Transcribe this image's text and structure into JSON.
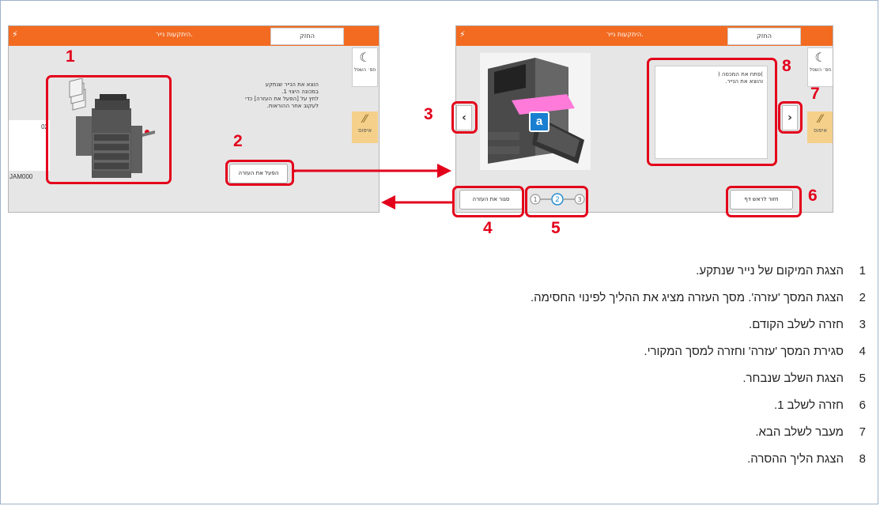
{
  "left_panel": {
    "bar_title": "היתקעות נייר.",
    "tab_label": "החזק",
    "sleep_label": "חס׳ השפל",
    "reset_label": "איפוס",
    "instructions": [
      "הוצא את הנייר שנתקע",
      "במכונה היצוי 1.",
      "לחץ על [הפעל את העזרה] כדי",
      "לעקוב אחר ההוראות."
    ],
    "help_button": "הפעל את העזרה",
    "partial_value": "02",
    "jam_code": "JAM000"
  },
  "right_panel": {
    "bar_title": "היתקעות נייר.",
    "tab_label": "החזק",
    "sleep_label": "חס׳ השפל",
    "reset_label": "איפוס",
    "instruction_lines": [
      ")פתח את המכסה (",
      "והוצא את הנייר."
    ],
    "close_help_button": "סגור את העזרה",
    "back_to_start_button": "חזור לראש דף",
    "part_badge": "a",
    "steps": [
      "1",
      "2",
      "3"
    ]
  },
  "callouts": [
    "1",
    "2",
    "3",
    "4",
    "5",
    "6",
    "7",
    "8"
  ],
  "descriptions": [
    {
      "num": "1",
      "text": "הצגת המיקום של נייר שנתקע."
    },
    {
      "num": "2",
      "text": "הצגת המסך 'עזרה'. מסך העזרה מציג את ההליך לפינוי החסימה."
    },
    {
      "num": "3",
      "text": "חזרה לשלב הקודם."
    },
    {
      "num": "4",
      "text": "סגירת המסך 'עזרה' וחזרה למסך המקורי."
    },
    {
      "num": "5",
      "text": "הצגת השלב שנבחר."
    },
    {
      "num": "6",
      "text": "חזרה לשלב 1."
    },
    {
      "num": "7",
      "text": "מעבר לשלב הבא."
    },
    {
      "num": "8",
      "text": "הצגת הליך ההסרה."
    }
  ],
  "colors": {
    "accent_orange": "#f26b21",
    "callout_red": "#e3001b",
    "step_blue": "#2a8fd0"
  }
}
